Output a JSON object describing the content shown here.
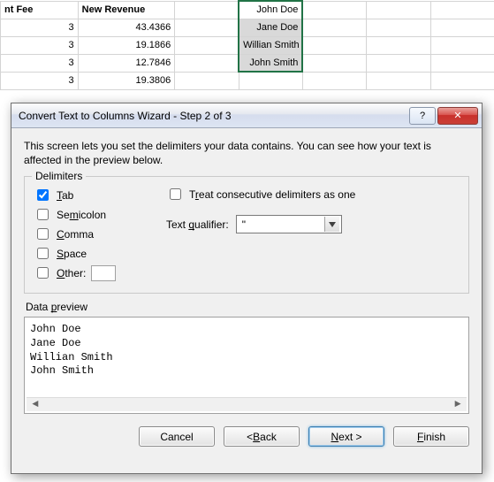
{
  "sheet": {
    "headers": {
      "a": "nt Fee",
      "b": "New Revenue"
    },
    "rows": [
      {
        "fee": "3",
        "rev": "43.4366",
        "name": "John Doe"
      },
      {
        "fee": "3",
        "rev": "19.1866",
        "name": "Jane Doe"
      },
      {
        "fee": "3",
        "rev": "12.7846",
        "name": "Willian Smith"
      },
      {
        "fee": "3",
        "rev": "19.3806",
        "name": "John Smith"
      }
    ]
  },
  "dialog": {
    "title": "Convert Text to Columns Wizard - Step 2 of 3",
    "intro": "This screen lets you set the delimiters your data contains.  You can see how your text is affected in the preview below.",
    "delimiters_label": "Delimiters",
    "tab_label": "Tab",
    "semicolon_label": "Semicolon",
    "comma_label": "Comma",
    "space_label": "Space",
    "other_label": "Other:",
    "treat_label": "Treat consecutive delimiters as one",
    "qualifier_label": "Text qualifier:",
    "qualifier_value": "\"",
    "preview_label": "Data preview",
    "preview_lines": [
      "John Doe",
      "Jane Doe",
      "Willian Smith",
      "John Smith"
    ],
    "buttons": {
      "cancel": "Cancel",
      "back": "< Back",
      "next": "Next >",
      "finish": "Finish"
    },
    "checked": {
      "tab": true,
      "semicolon": false,
      "comma": false,
      "space": false,
      "other": false,
      "treat": false
    }
  },
  "icons": {
    "help": "?",
    "close": "✕",
    "dropdown": "▾",
    "scroll_left": "◄",
    "scroll_right": "►"
  }
}
